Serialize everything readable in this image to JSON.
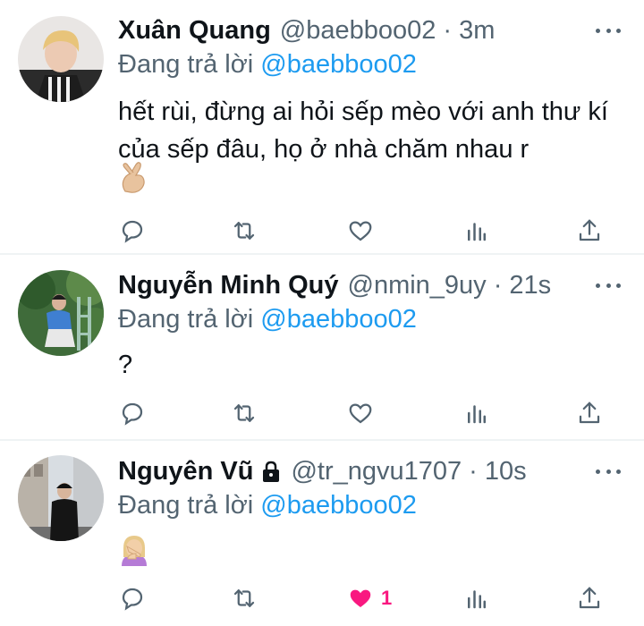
{
  "colors": {
    "accent": "#1d9bf0",
    "muted": "#536471",
    "like": "#f91880",
    "divider": "#eff3f4"
  },
  "tweets": [
    {
      "name": "Xuân Quang",
      "handle": "@baebboo02",
      "separator": "·",
      "time": "3m",
      "reply_prefix": "Đang trả lời ",
      "reply_to": "@baebboo02",
      "text": "hết rùi, đừng ai hỏi sếp mèo với anh thư kí của sếp đâu, họ ở nhà chăm nhau r",
      "emoji": "hand-with-index-finger-and-thumb-crossed-emoji",
      "like_count": ""
    },
    {
      "name": "Nguyễn Minh Quý",
      "handle": "@nmin_9uy",
      "separator": "·",
      "time": "21s",
      "reply_prefix": "Đang trả lời ",
      "reply_to": "@baebboo02",
      "text": "?",
      "like_count": ""
    },
    {
      "name": "Nguyên Vũ",
      "handle": "@tr_ngvu1707",
      "separator": "·",
      "time": "10s",
      "reply_prefix": "Đang trả lời ",
      "reply_to": "@baebboo02",
      "text": "",
      "emoji": "woman-facepalming-emoji",
      "protected_icon": "lock-icon",
      "liked": true,
      "like_count": "1"
    }
  ],
  "icons": {
    "reply": "reply-icon",
    "retweet": "retweet-icon",
    "like": "like-icon",
    "analytics": "analytics-icon",
    "share": "share-icon",
    "more": "more-icon"
  }
}
